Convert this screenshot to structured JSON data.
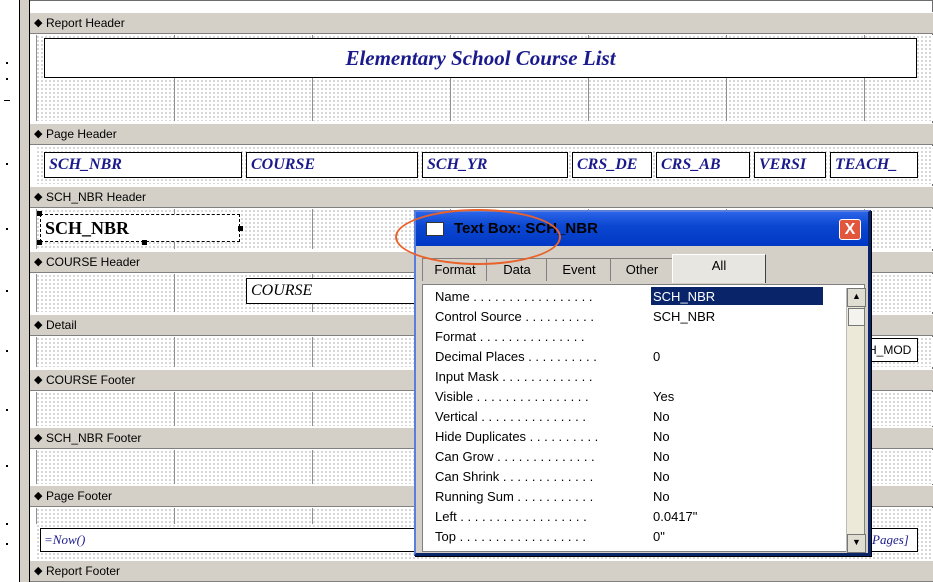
{
  "bands": {
    "report_header": "Report Header",
    "page_header": "Page Header",
    "sch_nbr_header": "SCH_NBR Header",
    "course_header": "COURSE Header",
    "detail": "Detail",
    "course_footer": "COURSE Footer",
    "sch_nbr_footer": "SCH_NBR Footer",
    "page_footer": "Page Footer",
    "report_footer": "Report Footer"
  },
  "band_icon": "hand-pointer-icon",
  "report_title": "Elementary School Course List",
  "page_header_fields": [
    "SCH_NBR",
    "COURSE",
    "SCH_YR",
    "CRS_DE",
    "CRS_AB",
    "VERSI",
    "TEACH_"
  ],
  "group_field_sch": "SCH_NBR",
  "group_field_course": "COURSE",
  "detail_partial": "H_MOD",
  "footer_left": "=Now()",
  "footer_right": "Pages]",
  "dialog": {
    "title": "Text Box: SCH_NBR",
    "close": "X",
    "tabs": [
      "Format",
      "Data",
      "Event",
      "Other",
      "All"
    ],
    "active_tab": "All",
    "properties": [
      {
        "label": "Name . . . . . . . . . . . . . . . . .",
        "value": "SCH_NBR"
      },
      {
        "label": "Control Source . . . . . . . . . .",
        "value": "SCH_NBR"
      },
      {
        "label": "Format . . . . . . . . . . . . . . .",
        "value": ""
      },
      {
        "label": "Decimal Places . . . . . . . . . .",
        "value": "0"
      },
      {
        "label": "Input Mask . . . . . . . . . . . . .",
        "value": ""
      },
      {
        "label": "Visible . . . . . . . . . . . . . . . .",
        "value": "Yes"
      },
      {
        "label": "Vertical . . . . . . . . . . . . . . .",
        "value": "No"
      },
      {
        "label": "Hide Duplicates . . . . . . . . . .",
        "value": "No"
      },
      {
        "label": "Can Grow . . . . . . . . . . . . . .",
        "value": "No"
      },
      {
        "label": "Can Shrink . . . . . . . . . . . . .",
        "value": "No"
      },
      {
        "label": "Running Sum . . . . . . . . . . .",
        "value": "No"
      },
      {
        "label": "Left . . . . . . . . . . . . . . . . . .",
        "value": "0.0417\""
      },
      {
        "label": "Top . . . . . . . . . . . . . . . . . .",
        "value": "0\""
      }
    ]
  }
}
